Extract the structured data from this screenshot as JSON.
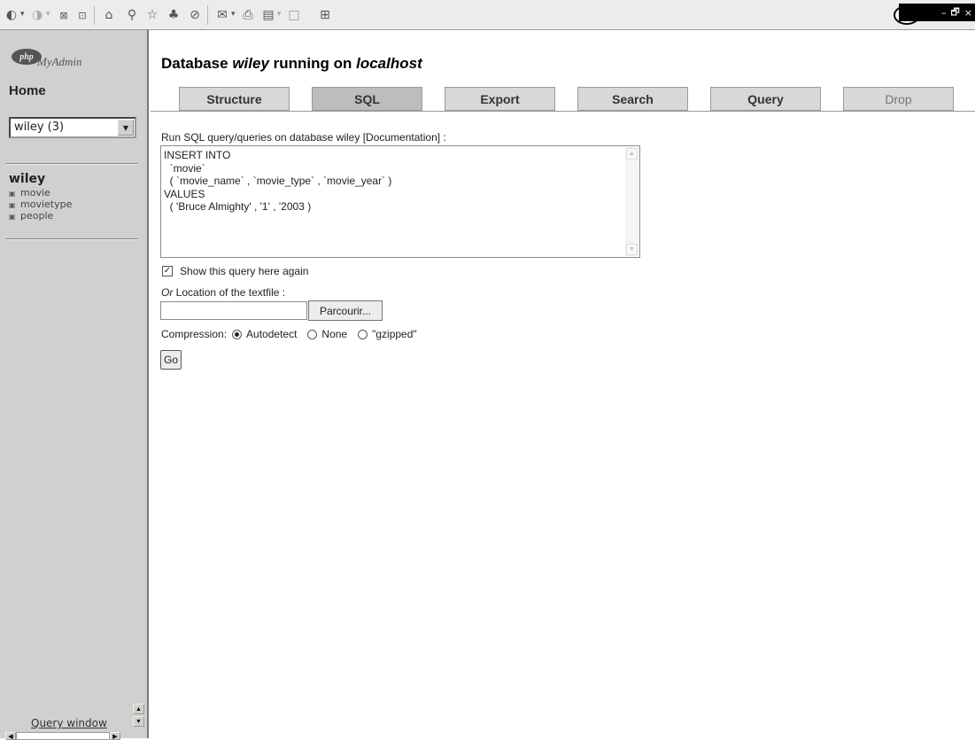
{
  "toolbar": {
    "icons": [
      "back-icon",
      "forward-icon",
      "stop-icon",
      "refresh-icon",
      "home-icon",
      "search-icon",
      "favorites-icon",
      "media-icon",
      "history-icon",
      "mail-icon",
      "print-icon",
      "edit-icon",
      "discuss-icon",
      "messenger-icon"
    ],
    "window_controls": [
      "–",
      "🗗",
      "×"
    ]
  },
  "sidebar": {
    "logo_php": "php",
    "logo_text": "MyAdmin",
    "home_label": "Home",
    "db_select_value": "wiley (3)",
    "db_name": "wiley",
    "tables": [
      {
        "name": "movie"
      },
      {
        "name": "movietype"
      },
      {
        "name": "people"
      }
    ],
    "query_window_label": "Query window"
  },
  "header": {
    "title_prefix": "Database ",
    "db": "wiley",
    "title_mid": " running on ",
    "host": "localhost"
  },
  "tabs": [
    {
      "label": "Structure",
      "active": false
    },
    {
      "label": "SQL",
      "active": true
    },
    {
      "label": "Export",
      "active": false
    },
    {
      "label": "Search",
      "active": false
    },
    {
      "label": "Query",
      "active": false
    },
    {
      "label": "Drop",
      "active": false
    }
  ],
  "form": {
    "run_label": "Run SQL query/queries on database wiley [Documentation] :",
    "sql_query": "INSERT INTO\n  `movie`\n  ( `movie_name` , `movie_type` , `movie_year` )\nVALUES\n  ( 'Bruce Almighty' , '1' , '2003 )",
    "show_again_label": "Show this query here again",
    "show_again_checked": true,
    "location_or": "Or",
    "location_label": " Location of the textfile :",
    "file_value": "",
    "browse_label": "Parcourir...",
    "compression_label": "Compression:",
    "compression_options": [
      "Autodetect",
      "None",
      "\"gzipped\""
    ],
    "compression_selected": "Autodetect",
    "go_label": "Go"
  }
}
